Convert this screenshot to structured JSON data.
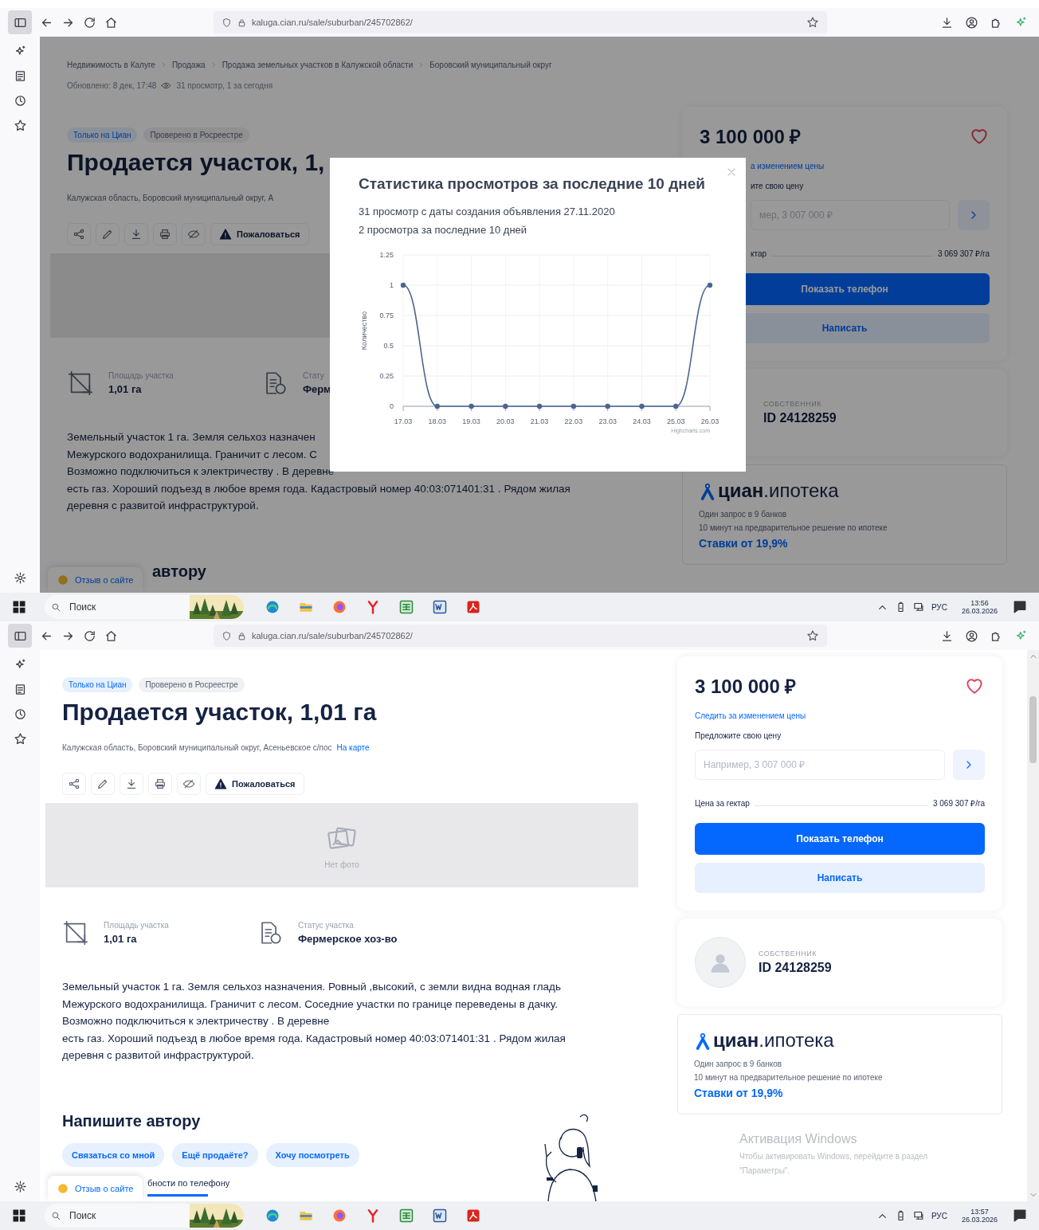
{
  "screens": [
    {
      "browser": {
        "url": "kaluga.cian.ru/sale/suburban/245702862/"
      },
      "page": {
        "breadcrumbs": [
          "Недвижимость в Калуге",
          "Продажа",
          "Продажа земельных участков в Калужской области",
          "Боровский муниципальный округ"
        ],
        "updated": "Обновлено: 8 дек, 17:48",
        "views": "31 просмотр, 1 за сегодня",
        "tags": [
          {
            "label": "Только на Циан",
            "kind": "cian"
          },
          {
            "label": "Проверено в Росреестре",
            "kind": "plain"
          }
        ],
        "title": "Продается участок, 1,",
        "address": "Калужская область, Боровский муниципальный округ, А",
        "report": "Пожаловаться",
        "stats": [
          {
            "label": "Площадь участка",
            "value": "1,01 га",
            "kind": "area"
          },
          {
            "label": "Стату",
            "value": "Ферм",
            "kind": "status"
          }
        ],
        "description": "Земельный участок 1 га. Земля сельхоз назначен\nМежурского водохранилища. Граничит с лесом. С\nВозможно подключиться к электричеству . В деревне\nесть газ. Хороший подъезд в любое время года. Кадастровый номер 40:03:071401:31 . Рядом жилая\nдеревня с развитой инфраструктурой.",
        "write_heading": "автору",
        "feedback": "Отзыв о сайте"
      },
      "card": {
        "price": "3 100 000 ₽",
        "track": "а изменением цены",
        "offer_label": "ите свою цену",
        "offer_placeholder": "мер, 3 007 000 ₽",
        "per_label": "ктар",
        "per_value": "3 069 307 ₽/га",
        "phone": "Показать телефон",
        "write": "Написать"
      },
      "owner": {
        "role": "СОБСТВЕННИК",
        "id": "ID 24128259"
      },
      "mortgage": {
        "logo": "**циан**.ипотека",
        "line_1": "Один запрос в 9 банков",
        "line_2": "10 минут на предварительное решение по ипотеке",
        "rates": "Ставки от 19,9%"
      },
      "modal": {
        "title": "Статистика просмотров за последние 10 дней",
        "line_1": "31 просмотр с даты создания объявления 27.11.2020",
        "line_2": "2 просмотра за последние 10 дней",
        "credit": "Highcharts.com",
        "chart_data": {
          "type": "line",
          "ylabel": "Количество",
          "categories": [
            "17.03",
            "18.03",
            "19.03",
            "20.03",
            "21.03",
            "22.03",
            "23.03",
            "24.03",
            "25.03",
            "26.03"
          ],
          "series": [
            {
              "color": "#4a6591",
              "marker": true,
              "values": [
                1,
                0,
                0,
                0,
                0,
                0,
                0,
                0,
                0,
                1
              ]
            }
          ],
          "ylim": [
            0,
            1.25
          ],
          "yticks": [
            0,
            0.25,
            0.5,
            0.75,
            1,
            1.25
          ],
          "grid": true
        }
      },
      "taskbar": {
        "search": {
          "placeholder": "Поиск"
        },
        "lang": "РУС",
        "time": "13:56",
        "date": "26.03.2026"
      }
    },
    {
      "browser": {
        "url": "kaluga.cian.ru/sale/suburban/245702862/"
      },
      "page": {
        "tags": [
          {
            "label": "Только на Циан",
            "kind": "cian"
          },
          {
            "label": "Проверено в Росреестре",
            "kind": "plain"
          }
        ],
        "title": "Продается участок, 1,01 га",
        "address": "Калужская область, Боровский муниципальный округ, Асеньевское с/пос",
        "map_link": "На карте",
        "report": "Пожаловаться",
        "photo_text": "Нет фото",
        "stats": [
          {
            "label": "Площадь участка",
            "value": "1,01 га",
            "kind": "area"
          },
          {
            "label": "Статус участка",
            "value": "Фермерское хоз-во",
            "kind": "status"
          }
        ],
        "description": "Земельный участок 1 га. Земля сельхоз назначения. Ровный ,высокий, с земли видна водная гладь\nМежурского водохранилища. Граничит с лесом. Соседние участки по границе переведены в дачку.\nВозможно подключиться к электричеству . В деревне\nесть газ. Хороший подъезд в любое время года. Кадастровый номер 40:03:071401:31 . Рядом жилая\nдеревня с развитой инфраструктурой.",
        "write_heading": "Напишите автору",
        "chips": [
          "Связаться со мной",
          "Ещё продаёте?",
          "Хочу посмотреть"
        ],
        "partial_text": "бности по телефону",
        "feedback": "Отзыв о сайте"
      },
      "card": {
        "price": "3 100 000 ₽",
        "track": "Следить за изменением цены",
        "offer_label": "Предложите свою цену",
        "offer_placeholder": "Например, 3 007 000 ₽",
        "per_label": "Цена за гектар",
        "per_value": "3 069 307 ₽/га",
        "phone": "Показать телефон",
        "write": "Написать"
      },
      "owner": {
        "role": "СОБСТВЕННИК",
        "id": "ID 24128259",
        "avatar": true
      },
      "mortgage": {
        "logo": "**циан**.ипотека",
        "line_1": "Один запрос в 9 банков",
        "line_2": "10 минут на предварительное решение по ипотеке",
        "rates": "Ставки от 19,9%"
      },
      "activation": {
        "title": "Активация Windows",
        "text": "Чтобы активировать Windows, перейдите в раздел\n\"Параметры\"."
      },
      "taskbar": {
        "search": {
          "placeholder": "Поиск"
        },
        "lang": "РУС",
        "time": "13:57",
        "date": "26.03.2026"
      }
    }
  ]
}
